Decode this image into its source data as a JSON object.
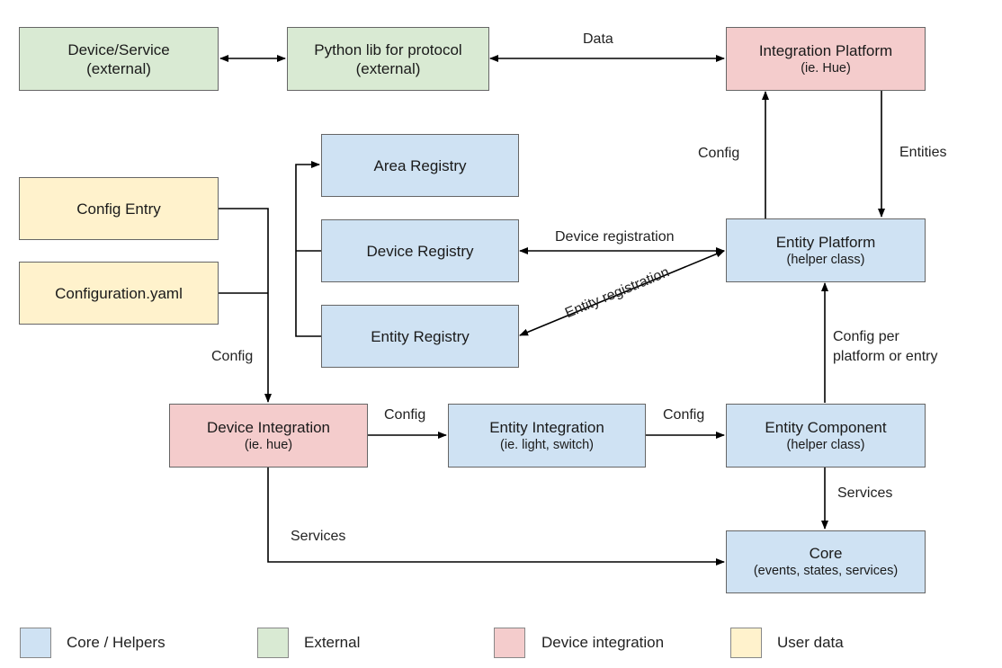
{
  "colors": {
    "core_helpers": "#cfe2f3",
    "external": "#d9ead3",
    "device_integration": "#f4cccc",
    "user_data": "#fff2cc",
    "border": "#666666",
    "line": "#000000"
  },
  "nodes": {
    "device_service": {
      "title": "Device/Service",
      "subtitle": "(external)",
      "category": "external"
    },
    "python_lib": {
      "title": "Python lib for protocol",
      "subtitle": "(external)",
      "category": "external"
    },
    "integration_platform": {
      "title": "Integration Platform",
      "subtitle": "(ie. Hue)",
      "category": "device_integration"
    },
    "area_registry": {
      "title": "Area Registry",
      "category": "core_helpers"
    },
    "device_registry": {
      "title": "Device Registry",
      "category": "core_helpers"
    },
    "entity_registry": {
      "title": "Entity Registry",
      "category": "core_helpers"
    },
    "config_entry": {
      "title": "Config Entry",
      "category": "user_data"
    },
    "configuration_yaml": {
      "title": "Configuration.yaml",
      "category": "user_data"
    },
    "entity_platform": {
      "title": "Entity Platform",
      "subtitle": "(helper class)",
      "category": "core_helpers"
    },
    "device_integration": {
      "title": "Device Integration",
      "subtitle": "(ie. hue)",
      "category": "device_integration"
    },
    "entity_integration": {
      "title": "Entity Integration",
      "subtitle": "(ie. light, switch)",
      "category": "core_helpers"
    },
    "entity_component": {
      "title": "Entity Component",
      "subtitle": "(helper class)",
      "category": "core_helpers"
    },
    "core": {
      "title": "Core",
      "subtitle": "(events, states, services)",
      "category": "core_helpers"
    }
  },
  "edges": [
    {
      "from": "device_service",
      "to": "python_lib",
      "label": "",
      "bidirectional": true
    },
    {
      "from": "python_lib",
      "to": "integration_platform",
      "label": "Data",
      "bidirectional": true
    },
    {
      "from": "entity_platform",
      "to": "integration_platform",
      "label": "Config"
    },
    {
      "from": "integration_platform",
      "to": "entity_platform",
      "label": "Entities"
    },
    {
      "from": "device_registry",
      "to": "entity_platform",
      "label": "Device registration",
      "bidirectional": true
    },
    {
      "from": "entity_registry",
      "to": "entity_platform",
      "label": "Entity registration",
      "bidirectional": true
    },
    {
      "from": "device_registry",
      "to": "area_registry",
      "label": ""
    },
    {
      "from": "entity_registry",
      "to": "area_registry",
      "label": ""
    },
    {
      "from": "config_entry",
      "to": "device_integration",
      "label": "Config"
    },
    {
      "from": "configuration_yaml",
      "to": "device_integration",
      "label": "Config"
    },
    {
      "from": "device_integration",
      "to": "entity_integration",
      "label": "Config"
    },
    {
      "from": "entity_integration",
      "to": "entity_component",
      "label": "Config"
    },
    {
      "from": "entity_component",
      "to": "entity_platform",
      "label": "Config per platform or entry"
    },
    {
      "from": "entity_component",
      "to": "core",
      "label": "Services"
    },
    {
      "from": "device_integration",
      "to": "core",
      "label": "Services"
    }
  ],
  "labels": {
    "data": "Data",
    "config_ip": "Config",
    "entities": "Entities",
    "device_registration": "Device registration",
    "entity_registration": "Entity registration",
    "config_left": "Config",
    "config_di_ei": "Config",
    "config_ei_ec": "Config",
    "config_per_line1": "Config per",
    "config_per_line2": "platform or entry",
    "services_ec_core": "Services",
    "services_di_core": "Services"
  },
  "legend": [
    {
      "label": "Core / Helpers",
      "color": "#cfe2f3"
    },
    {
      "label": "External",
      "color": "#d9ead3"
    },
    {
      "label": "Device integration",
      "color": "#f4cccc"
    },
    {
      "label": "User data",
      "color": "#fff2cc"
    }
  ]
}
